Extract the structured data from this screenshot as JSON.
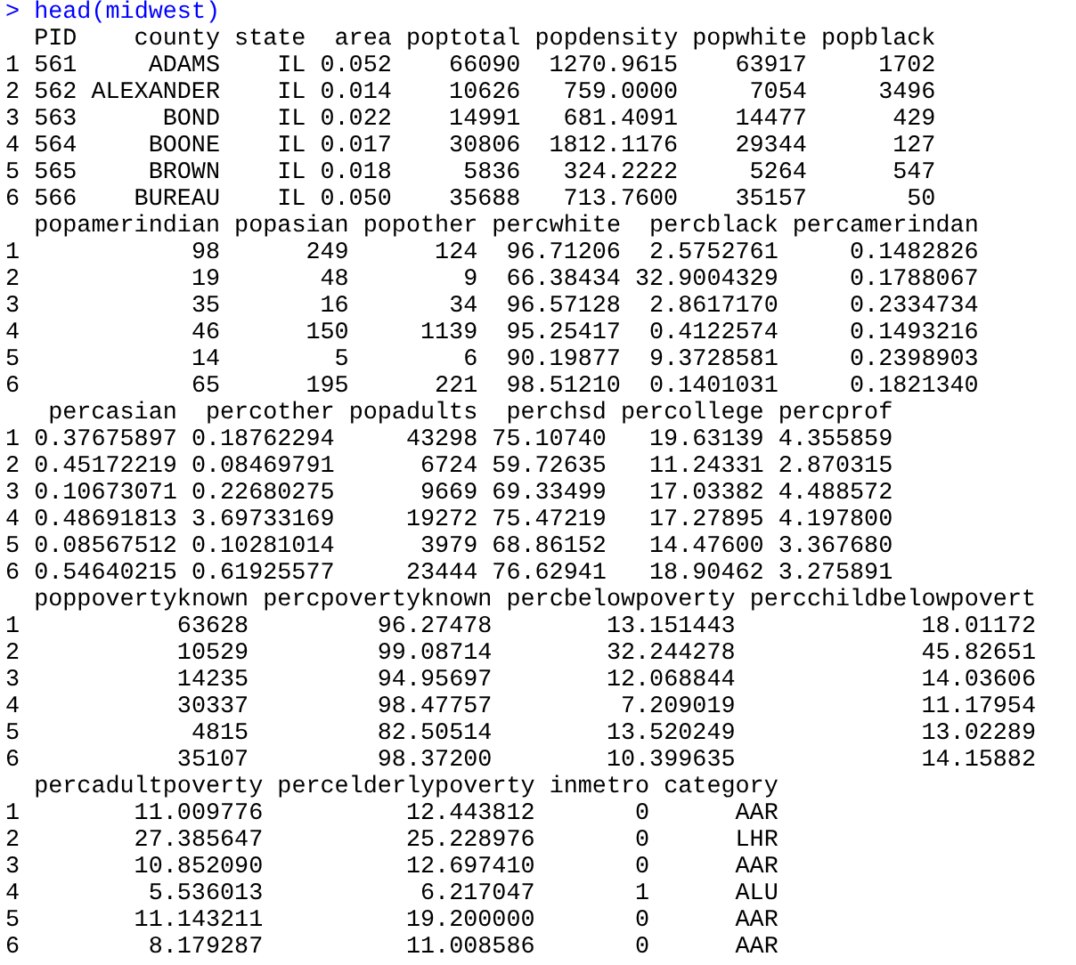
{
  "console": {
    "prompt": ">",
    "command": "head(midwest)",
    "blocks": [
      {
        "columns": [
          "PID",
          "county",
          "state",
          "area",
          "poptotal",
          "popdensity",
          "popwhite",
          "popblack"
        ],
        "rows": [
          {
            "index": "1",
            "cells": [
              "561",
              "ADAMS",
              "IL",
              "0.052",
              "66090",
              "1270.9615",
              "63917",
              "1702"
            ]
          },
          {
            "index": "2",
            "cells": [
              "562",
              "ALEXANDER",
              "IL",
              "0.014",
              "10626",
              "759.0000",
              "7054",
              "3496"
            ]
          },
          {
            "index": "3",
            "cells": [
              "563",
              "BOND",
              "IL",
              "0.022",
              "14991",
              "681.4091",
              "14477",
              "429"
            ]
          },
          {
            "index": "4",
            "cells": [
              "564",
              "BOONE",
              "IL",
              "0.017",
              "30806",
              "1812.1176",
              "29344",
              "127"
            ]
          },
          {
            "index": "5",
            "cells": [
              "565",
              "BROWN",
              "IL",
              "0.018",
              "5836",
              "324.2222",
              "5264",
              "547"
            ]
          },
          {
            "index": "6",
            "cells": [
              "566",
              "BUREAU",
              "IL",
              "0.050",
              "35688",
              "713.7600",
              "35157",
              "50"
            ]
          }
        ]
      },
      {
        "columns": [
          "popamerindian",
          "popasian",
          "popother",
          "percwhite",
          "percblack",
          "percamerindan"
        ],
        "rows": [
          {
            "index": "1",
            "cells": [
              "98",
              "249",
              "124",
              "96.71206",
              "2.5752761",
              "0.1482826"
            ]
          },
          {
            "index": "2",
            "cells": [
              "19",
              "48",
              "9",
              "66.38434",
              "32.9004329",
              "0.1788067"
            ]
          },
          {
            "index": "3",
            "cells": [
              "35",
              "16",
              "34",
              "96.57128",
              "2.8617170",
              "0.2334734"
            ]
          },
          {
            "index": "4",
            "cells": [
              "46",
              "150",
              "1139",
              "95.25417",
              "0.4122574",
              "0.1493216"
            ]
          },
          {
            "index": "5",
            "cells": [
              "14",
              "5",
              "6",
              "90.19877",
              "9.3728581",
              "0.2398903"
            ]
          },
          {
            "index": "6",
            "cells": [
              "65",
              "195",
              "221",
              "98.51210",
              "0.1401031",
              "0.1821340"
            ]
          }
        ]
      },
      {
        "columns": [
          "percasian",
          "percother",
          "popadults",
          "perchsd",
          "percollege",
          "percprof"
        ],
        "rows": [
          {
            "index": "1",
            "cells": [
              "0.37675897",
              "0.18762294",
              "43298",
              "75.10740",
              "19.63139",
              "4.355859"
            ]
          },
          {
            "index": "2",
            "cells": [
              "0.45172219",
              "0.08469791",
              "6724",
              "59.72635",
              "11.24331",
              "2.870315"
            ]
          },
          {
            "index": "3",
            "cells": [
              "0.10673071",
              "0.22680275",
              "9669",
              "69.33499",
              "17.03382",
              "4.488572"
            ]
          },
          {
            "index": "4",
            "cells": [
              "0.48691813",
              "3.69733169",
              "19272",
              "75.47219",
              "17.27895",
              "4.197800"
            ]
          },
          {
            "index": "5",
            "cells": [
              "0.08567512",
              "0.10281014",
              "3979",
              "68.86152",
              "14.47600",
              "3.367680"
            ]
          },
          {
            "index": "6",
            "cells": [
              "0.54640215",
              "0.61925577",
              "23444",
              "76.62941",
              "18.90462",
              "3.275891"
            ]
          }
        ]
      },
      {
        "columns": [
          "poppovertyknown",
          "percpovertyknown",
          "percbelowpoverty",
          "percchildbelowpovert"
        ],
        "rows": [
          {
            "index": "1",
            "cells": [
              "63628",
              "96.27478",
              "13.151443",
              "18.01172"
            ]
          },
          {
            "index": "2",
            "cells": [
              "10529",
              "99.08714",
              "32.244278",
              "45.82651"
            ]
          },
          {
            "index": "3",
            "cells": [
              "14235",
              "94.95697",
              "12.068844",
              "14.03606"
            ]
          },
          {
            "index": "4",
            "cells": [
              "30337",
              "98.47757",
              "7.209019",
              "11.17954"
            ]
          },
          {
            "index": "5",
            "cells": [
              "4815",
              "82.50514",
              "13.520249",
              "13.02289"
            ]
          },
          {
            "index": "6",
            "cells": [
              "35107",
              "98.37200",
              "10.399635",
              "14.15882"
            ]
          }
        ]
      },
      {
        "columns": [
          "percadultpoverty",
          "percelderlypoverty",
          "inmetro",
          "category"
        ],
        "rows": [
          {
            "index": "1",
            "cells": [
              "11.009776",
              "12.443812",
              "0",
              "AAR"
            ]
          },
          {
            "index": "2",
            "cells": [
              "27.385647",
              "25.228976",
              "0",
              "LHR"
            ]
          },
          {
            "index": "3",
            "cells": [
              "10.852090",
              "12.697410",
              "0",
              "AAR"
            ]
          },
          {
            "index": "4",
            "cells": [
              "5.536013",
              "6.217047",
              "1",
              "ALU"
            ]
          },
          {
            "index": "5",
            "cells": [
              "11.143211",
              "19.200000",
              "0",
              "AAR"
            ]
          },
          {
            "index": "6",
            "cells": [
              "8.179287",
              "11.008586",
              "0",
              "AAR"
            ]
          }
        ]
      }
    ]
  }
}
